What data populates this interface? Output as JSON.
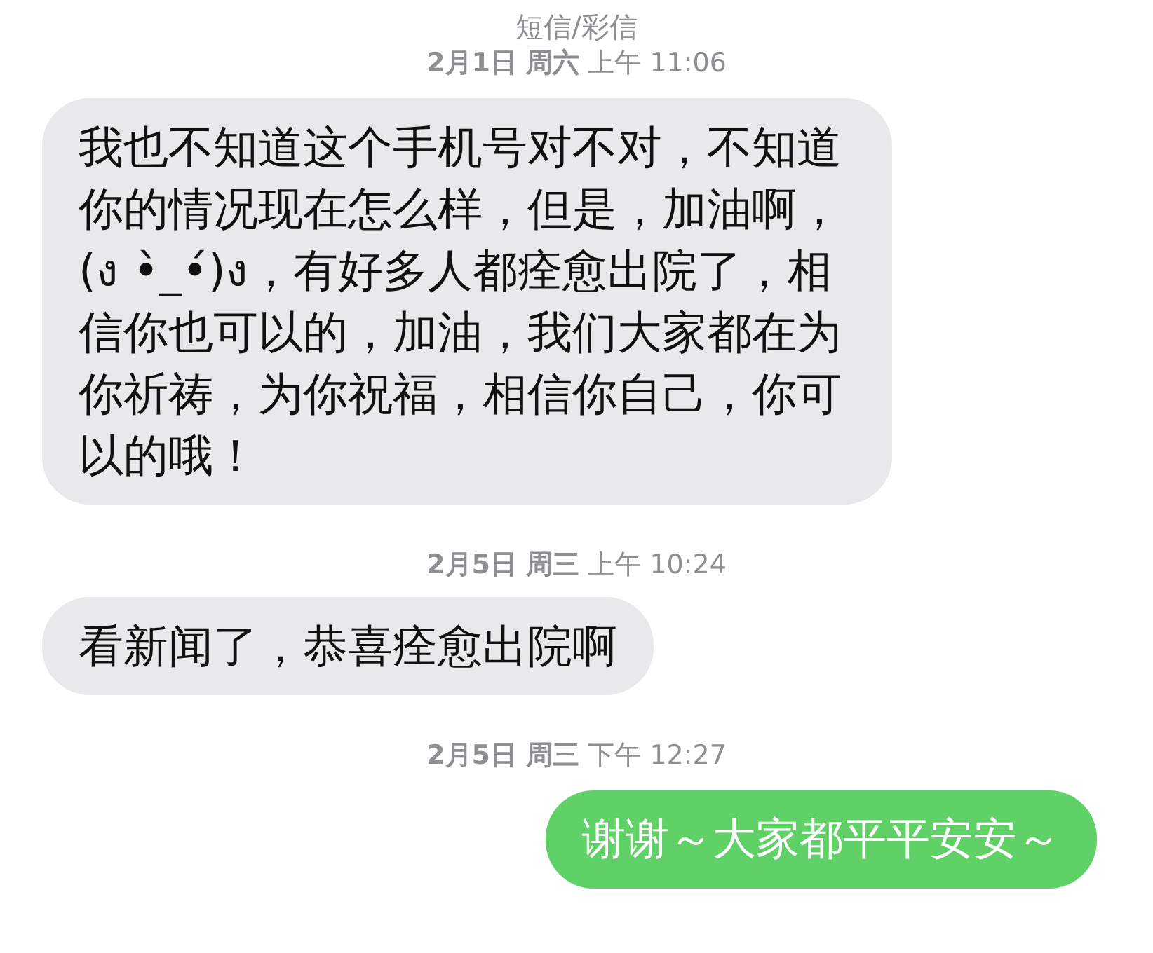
{
  "header": {
    "title": "短信/彩信"
  },
  "conversation": [
    {
      "kind": "timestamp",
      "text": "**2月1日 周六** 上午 11:06"
    },
    {
      "kind": "incoming",
      "text": "我也不知道这个手机号对不对，不知道你的情况现在怎么样，但是，加油啊，(ง •̀_•́)ง，有好多人都痊愈出院了，相信你也可以的，加油，我们大家都在为你祈祷，为你祝福，相信你自己，你可以的哦！"
    },
    {
      "kind": "timestamp",
      "text": "**2月5日 周三** 上午 10:24"
    },
    {
      "kind": "incoming",
      "text": "看新闻了，恭喜痊愈出院啊"
    },
    {
      "kind": "timestamp",
      "text": "**2月5日 周三** 下午 12:27"
    },
    {
      "kind": "outgoing",
      "text": "谢谢～大家都平平安安～"
    }
  ]
}
